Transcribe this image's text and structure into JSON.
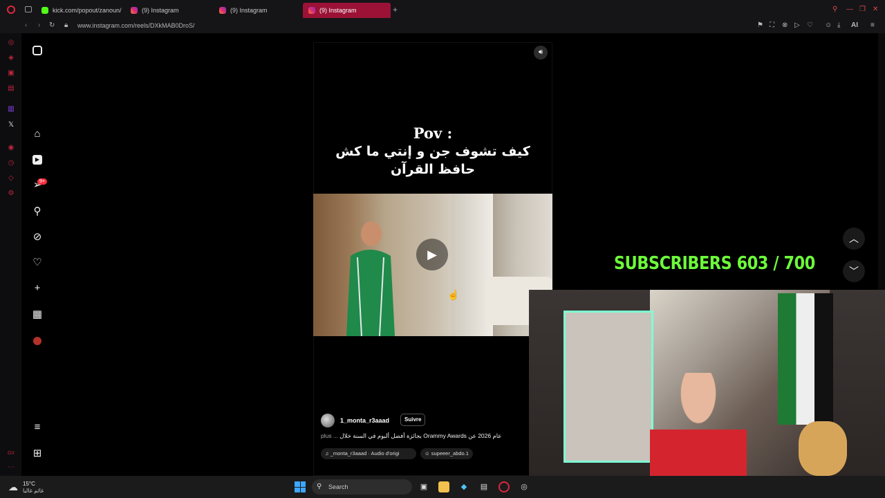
{
  "browser": {
    "tabs": [
      {
        "label": "kick.com/popout/zanoun/",
        "icon": "kick-favicon"
      },
      {
        "label": "(9) Instagram",
        "icon": "instagram-favicon"
      },
      {
        "label": "(9) Instagram",
        "icon": "instagram-favicon"
      },
      {
        "label": "(9) Instagram",
        "icon": "instagram-favicon",
        "active": true
      }
    ],
    "url": "www.instagram.com/reels/DXkMAB0DroS/",
    "ai_label": "AI"
  },
  "instagram_nav": {
    "notifications_badge": "9+"
  },
  "reel": {
    "title_line1": "Pov :",
    "title_line2": "كيف تشوف جن و إنتي ما كش",
    "title_line3": "حافظ القرآن",
    "username": "1_monta_r3aaad",
    "follow_label": "Suivre",
    "caption": "بجائزة أفضل ألبوم في السنة خلال Orammy Awards عام 2026 عن",
    "caption_more": "plus ...",
    "audio_label": "_monta_r3aaad · Audio d'origi",
    "tagged_user": "supeeer_abdo.1"
  },
  "overlay": {
    "subscribers_text": "SUBSCRIBERS 603 / 700",
    "subscribers_color": "#6dfb3a"
  },
  "taskbar": {
    "temperature": "15°C",
    "weather_desc": "غائم غالبا",
    "search_label": "Search"
  }
}
